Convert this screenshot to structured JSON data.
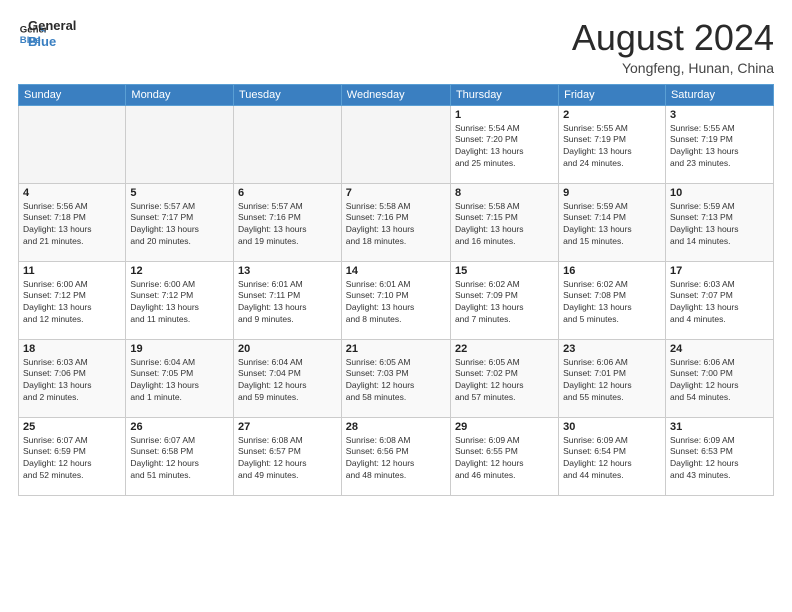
{
  "header": {
    "logo_line1": "General",
    "logo_line2": "Blue",
    "month": "August 2024",
    "location": "Yongfeng, Hunan, China"
  },
  "weekdays": [
    "Sunday",
    "Monday",
    "Tuesday",
    "Wednesday",
    "Thursday",
    "Friday",
    "Saturday"
  ],
  "weeks": [
    [
      {
        "day": "",
        "info": ""
      },
      {
        "day": "",
        "info": ""
      },
      {
        "day": "",
        "info": ""
      },
      {
        "day": "",
        "info": ""
      },
      {
        "day": "1",
        "info": "Sunrise: 5:54 AM\nSunset: 7:20 PM\nDaylight: 13 hours\nand 25 minutes."
      },
      {
        "day": "2",
        "info": "Sunrise: 5:55 AM\nSunset: 7:19 PM\nDaylight: 13 hours\nand 24 minutes."
      },
      {
        "day": "3",
        "info": "Sunrise: 5:55 AM\nSunset: 7:19 PM\nDaylight: 13 hours\nand 23 minutes."
      }
    ],
    [
      {
        "day": "4",
        "info": "Sunrise: 5:56 AM\nSunset: 7:18 PM\nDaylight: 13 hours\nand 21 minutes."
      },
      {
        "day": "5",
        "info": "Sunrise: 5:57 AM\nSunset: 7:17 PM\nDaylight: 13 hours\nand 20 minutes."
      },
      {
        "day": "6",
        "info": "Sunrise: 5:57 AM\nSunset: 7:16 PM\nDaylight: 13 hours\nand 19 minutes."
      },
      {
        "day": "7",
        "info": "Sunrise: 5:58 AM\nSunset: 7:16 PM\nDaylight: 13 hours\nand 18 minutes."
      },
      {
        "day": "8",
        "info": "Sunrise: 5:58 AM\nSunset: 7:15 PM\nDaylight: 13 hours\nand 16 minutes."
      },
      {
        "day": "9",
        "info": "Sunrise: 5:59 AM\nSunset: 7:14 PM\nDaylight: 13 hours\nand 15 minutes."
      },
      {
        "day": "10",
        "info": "Sunrise: 5:59 AM\nSunset: 7:13 PM\nDaylight: 13 hours\nand 14 minutes."
      }
    ],
    [
      {
        "day": "11",
        "info": "Sunrise: 6:00 AM\nSunset: 7:12 PM\nDaylight: 13 hours\nand 12 minutes."
      },
      {
        "day": "12",
        "info": "Sunrise: 6:00 AM\nSunset: 7:12 PM\nDaylight: 13 hours\nand 11 minutes."
      },
      {
        "day": "13",
        "info": "Sunrise: 6:01 AM\nSunset: 7:11 PM\nDaylight: 13 hours\nand 9 minutes."
      },
      {
        "day": "14",
        "info": "Sunrise: 6:01 AM\nSunset: 7:10 PM\nDaylight: 13 hours\nand 8 minutes."
      },
      {
        "day": "15",
        "info": "Sunrise: 6:02 AM\nSunset: 7:09 PM\nDaylight: 13 hours\nand 7 minutes."
      },
      {
        "day": "16",
        "info": "Sunrise: 6:02 AM\nSunset: 7:08 PM\nDaylight: 13 hours\nand 5 minutes."
      },
      {
        "day": "17",
        "info": "Sunrise: 6:03 AM\nSunset: 7:07 PM\nDaylight: 13 hours\nand 4 minutes."
      }
    ],
    [
      {
        "day": "18",
        "info": "Sunrise: 6:03 AM\nSunset: 7:06 PM\nDaylight: 13 hours\nand 2 minutes."
      },
      {
        "day": "19",
        "info": "Sunrise: 6:04 AM\nSunset: 7:05 PM\nDaylight: 13 hours\nand 1 minute."
      },
      {
        "day": "20",
        "info": "Sunrise: 6:04 AM\nSunset: 7:04 PM\nDaylight: 12 hours\nand 59 minutes."
      },
      {
        "day": "21",
        "info": "Sunrise: 6:05 AM\nSunset: 7:03 PM\nDaylight: 12 hours\nand 58 minutes."
      },
      {
        "day": "22",
        "info": "Sunrise: 6:05 AM\nSunset: 7:02 PM\nDaylight: 12 hours\nand 57 minutes."
      },
      {
        "day": "23",
        "info": "Sunrise: 6:06 AM\nSunset: 7:01 PM\nDaylight: 12 hours\nand 55 minutes."
      },
      {
        "day": "24",
        "info": "Sunrise: 6:06 AM\nSunset: 7:00 PM\nDaylight: 12 hours\nand 54 minutes."
      }
    ],
    [
      {
        "day": "25",
        "info": "Sunrise: 6:07 AM\nSunset: 6:59 PM\nDaylight: 12 hours\nand 52 minutes."
      },
      {
        "day": "26",
        "info": "Sunrise: 6:07 AM\nSunset: 6:58 PM\nDaylight: 12 hours\nand 51 minutes."
      },
      {
        "day": "27",
        "info": "Sunrise: 6:08 AM\nSunset: 6:57 PM\nDaylight: 12 hours\nand 49 minutes."
      },
      {
        "day": "28",
        "info": "Sunrise: 6:08 AM\nSunset: 6:56 PM\nDaylight: 12 hours\nand 48 minutes."
      },
      {
        "day": "29",
        "info": "Sunrise: 6:09 AM\nSunset: 6:55 PM\nDaylight: 12 hours\nand 46 minutes."
      },
      {
        "day": "30",
        "info": "Sunrise: 6:09 AM\nSunset: 6:54 PM\nDaylight: 12 hours\nand 44 minutes."
      },
      {
        "day": "31",
        "info": "Sunrise: 6:09 AM\nSunset: 6:53 PM\nDaylight: 12 hours\nand 43 minutes."
      }
    ]
  ]
}
